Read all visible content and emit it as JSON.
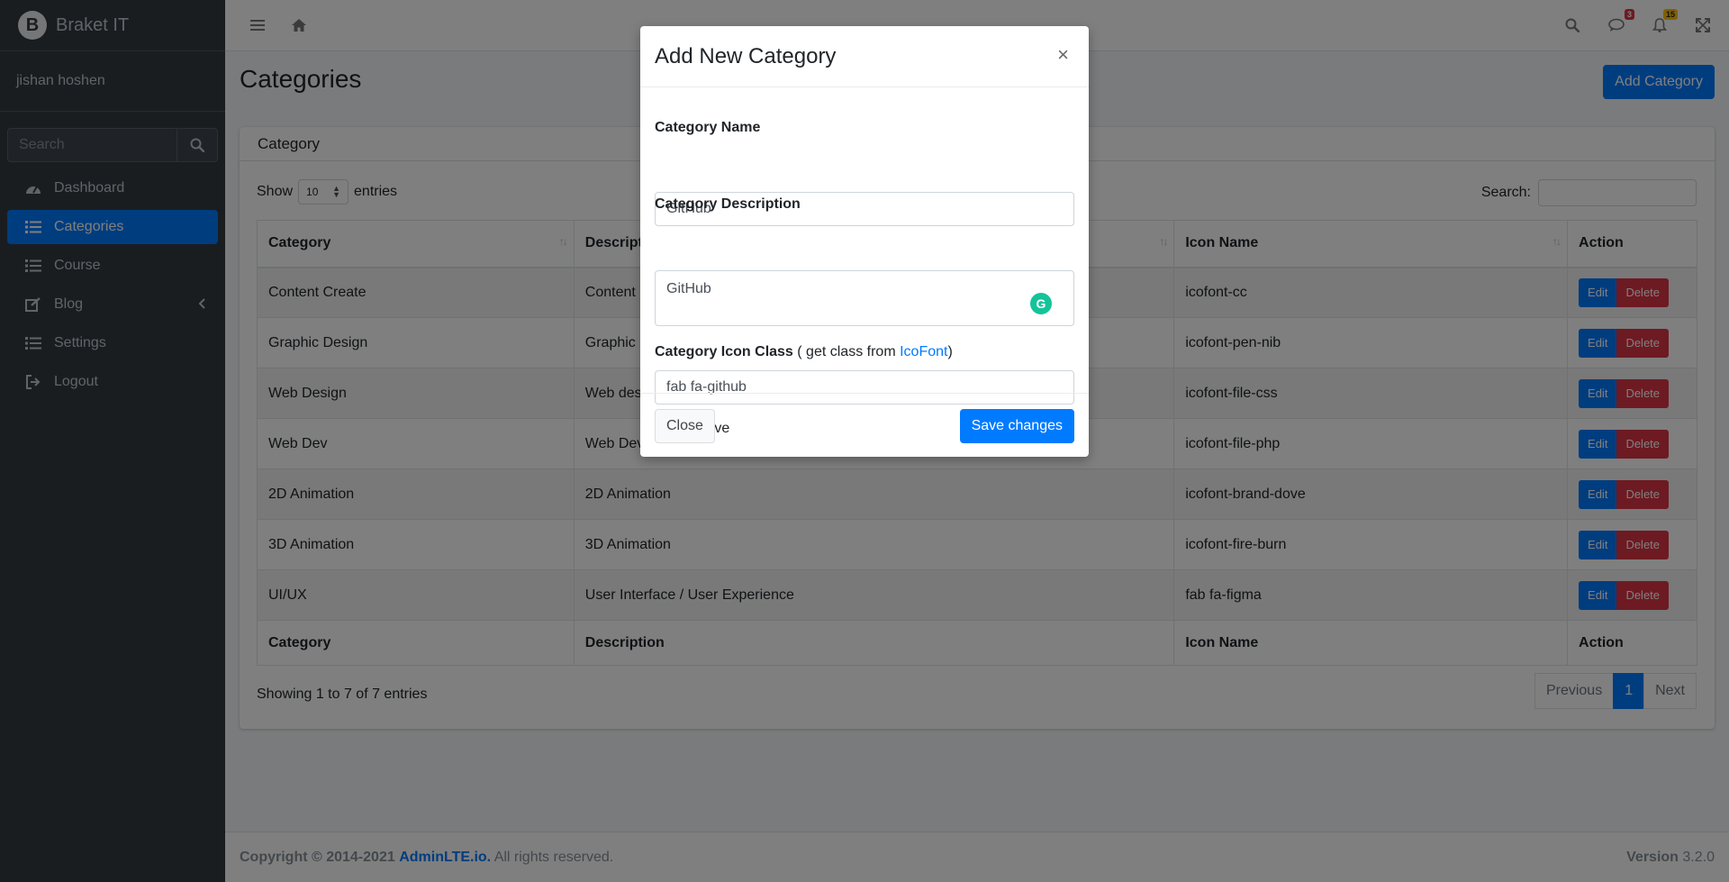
{
  "brand": {
    "name": "Braket IT",
    "logo_letter": "B"
  },
  "user": {
    "name": "jishan hoshen"
  },
  "sidebar": {
    "search_placeholder": "Search",
    "items": [
      {
        "label": "Dashboard",
        "icon": "tachometer-icon"
      },
      {
        "label": "Categories",
        "icon": "list-icon",
        "active": true
      },
      {
        "label": "Course",
        "icon": "list-icon"
      },
      {
        "label": "Blog",
        "icon": "edit-icon"
      },
      {
        "label": "Settings",
        "icon": "list-icon"
      },
      {
        "label": "Logout",
        "icon": "sign-out-icon"
      }
    ]
  },
  "navbar": {
    "messages_count": "3",
    "notifications_count": "15"
  },
  "page": {
    "title": "Categories",
    "add_button": "Add Category"
  },
  "card": {
    "header": "Category",
    "show_label": "Show",
    "show_value": "10",
    "entries_label": "entries",
    "search_label": "Search:",
    "columns": [
      "Category",
      "Description",
      "Icon Name",
      "Action"
    ],
    "rows": [
      {
        "category": "Content Create",
        "description": "Content",
        "icon_name": "icofont-cc"
      },
      {
        "category": "Graphic Design",
        "description": "Graphic",
        "icon_name": "icofont-pen-nib"
      },
      {
        "category": "Web Design",
        "description": "Web des",
        "icon_name": "icofont-file-css"
      },
      {
        "category": "Web Dev",
        "description": "Web Dev",
        "icon_name": "icofont-file-php"
      },
      {
        "category": "2D Animation",
        "description": "2D Animation",
        "icon_name": "icofont-brand-dove"
      },
      {
        "category": "3D Animation",
        "description": "3D Animation",
        "icon_name": "icofont-fire-burn"
      },
      {
        "category": "UI/UX",
        "description": "User Interface / User Experience",
        "icon_name": "fab fa-figma"
      }
    ],
    "edit_label": "Edit",
    "delete_label": "Delete",
    "info": "Showing 1 to 7 of 7 entries",
    "pager": {
      "previous": "Previous",
      "current": "1",
      "next": "Next"
    }
  },
  "footer": {
    "copyright": "Copyright © 2014-2021",
    "link": "AdminLTE.io.",
    "rights": "All rights reserved.",
    "version_label": "Version",
    "version": "3.2.0"
  },
  "modal": {
    "title": "Add New Category",
    "close_symbol": "×",
    "name_label": "Category Name",
    "name_value": "GitHub",
    "desc_label": "Category Description",
    "desc_value": "GitHub",
    "icon_label": "Category Icon Class",
    "icon_hint_pre": "( get class from",
    "icon_hint_link": "IcoFont",
    "icon_hint_post": ")",
    "icon_value": "fab fa-github",
    "deactive_label": "Deactive",
    "close_button": "Close",
    "save_button": "Save changes"
  }
}
